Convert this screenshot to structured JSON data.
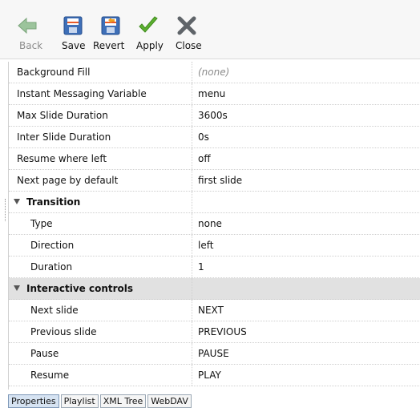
{
  "toolbar": {
    "buttons": [
      {
        "label": "Back",
        "icon": "back-arrow-icon",
        "enabled": false
      },
      {
        "label": "Save",
        "icon": "save-icon",
        "enabled": true
      },
      {
        "label": "Revert",
        "icon": "revert-icon",
        "enabled": true
      },
      {
        "label": "Apply",
        "icon": "checkmark-icon",
        "enabled": true
      },
      {
        "label": "Close",
        "icon": "close-x-icon",
        "enabled": true
      }
    ]
  },
  "properties": {
    "rows": [
      {
        "key": "Background Fill",
        "value": "(none)"
      },
      {
        "key": "Instant Messaging Variable",
        "value": "menu"
      },
      {
        "key": "Max Slide Duration",
        "value": "3600s"
      },
      {
        "key": "Inter Slide Duration",
        "value": "0s"
      },
      {
        "key": "Resume where left",
        "value": "off"
      },
      {
        "key": "Next page by default",
        "value": "first slide"
      }
    ],
    "transition": {
      "label": "Transition",
      "rows": [
        {
          "key": "Type",
          "value": "none"
        },
        {
          "key": "Direction",
          "value": "left"
        },
        {
          "key": "Duration",
          "value": "1"
        }
      ]
    },
    "interactive": {
      "label": "Interactive controls",
      "rows": [
        {
          "key": "Next slide",
          "value": "NEXT"
        },
        {
          "key": "Previous slide",
          "value": "PREVIOUS"
        },
        {
          "key": "Pause",
          "value": "PAUSE"
        },
        {
          "key": "Resume",
          "value": "PLAY"
        }
      ]
    }
  },
  "tabs": [
    {
      "label": "Properties",
      "active": true
    },
    {
      "label": "Playlist",
      "active": false
    },
    {
      "label": "XML Tree",
      "active": false
    },
    {
      "label": "WebDAV",
      "active": false
    }
  ],
  "colors": {
    "back_arrow": "#9cc49c",
    "save_blue": "#3e6fb8",
    "check_green": "#5cb030",
    "close_gray": "#5f6469",
    "group_row_bg": "#e1e1e1",
    "active_tab_bg": "#d6e3f2"
  }
}
